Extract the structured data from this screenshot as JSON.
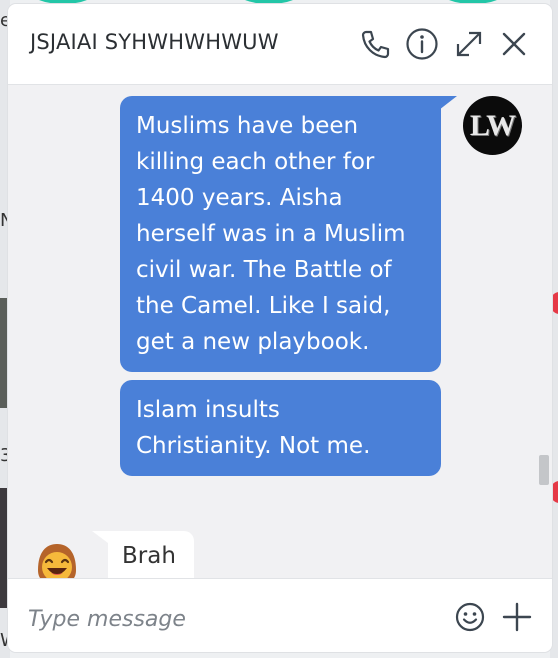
{
  "background": {
    "left_fragments": [
      "ei",
      "N",
      "3",
      "W"
    ]
  },
  "chat": {
    "title": "JSJAIAI SYHWHWHWUW",
    "header_icons": [
      "phone-icon",
      "info-icon",
      "expand-icon",
      "close-icon"
    ],
    "messages": [
      {
        "direction": "outgoing",
        "sender_avatar_text": "LW",
        "text": "Muslims have been killing each other for 1400 years. Aisha herself was in a Muslim civil war. The Battle of the Camel. Like I said, get a new playbook.",
        "lines": [
          "Muslims have been",
          "killing each other for",
          "1400 years. Aisha",
          "herself was in a Muslim",
          "civil war. The Battle of",
          "the Camel. Like I said,",
          "get a new playbook."
        ]
      },
      {
        "direction": "outgoing",
        "text": "Islam insults Christianity. Not me.",
        "lines": [
          "Islam insults",
          "Christianity. Not me."
        ]
      },
      {
        "direction": "incoming",
        "sender_avatar": "grinning-emoji-avatar",
        "text": "Brah"
      }
    ],
    "composer": {
      "placeholder": "Type message",
      "value": "",
      "icons": [
        "emoji-icon",
        "plus-icon"
      ]
    }
  },
  "colors": {
    "outgoing_bubble": "#4a80d8",
    "incoming_bubble": "#ffffff",
    "window_background": "#f1f1f3",
    "accent_teal": "#23c6a7",
    "notification_red": "#e53946"
  }
}
